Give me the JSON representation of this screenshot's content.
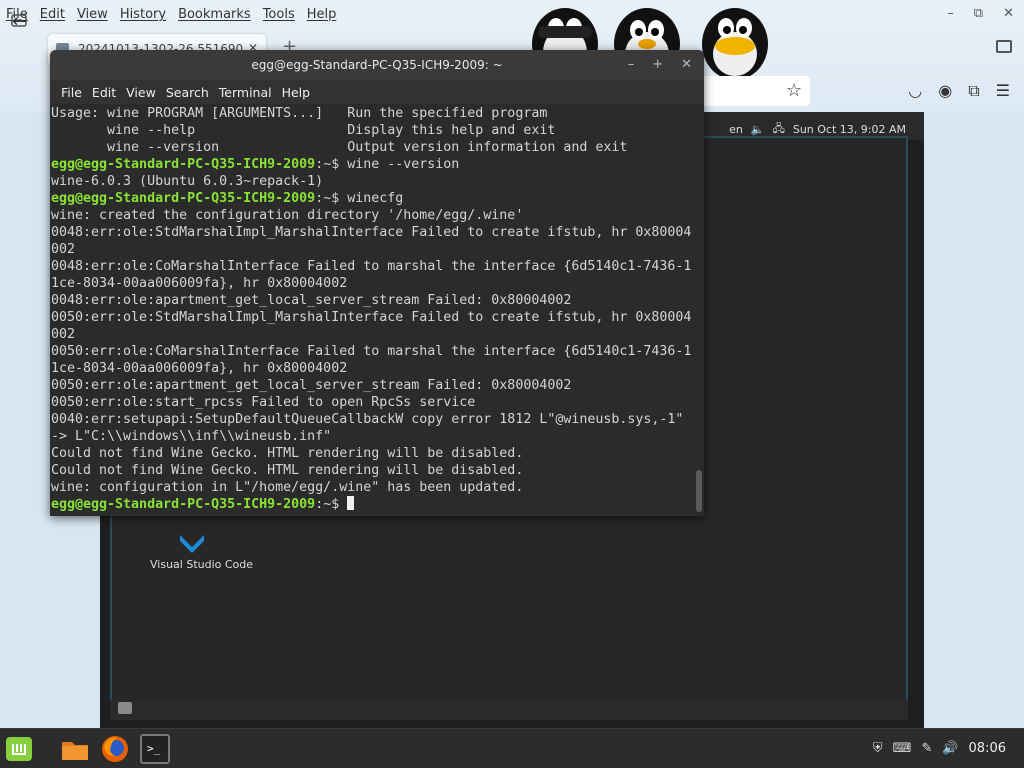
{
  "browser": {
    "menu": [
      "File",
      "Edit",
      "View",
      "History",
      "Bookmarks",
      "Tools",
      "Help"
    ],
    "tab_title": "20241013-1302-26.551690",
    "new_tab_label": "+",
    "window_controls": {
      "minimize": "–",
      "restore": "⧉",
      "close": "✕"
    }
  },
  "vm": {
    "tray_lang": "en",
    "tray_datetime": "Sun Oct 13,  9:02 AM",
    "desktop_icon_label": "Visual Studio Code"
  },
  "terminal": {
    "title": "egg@egg-Standard-PC-Q35-ICH9-2009: ~",
    "menu": [
      "File",
      "Edit",
      "View",
      "Search",
      "Terminal",
      "Help"
    ],
    "lines": [
      {
        "text": "Usage: wine PROGRAM [ARGUMENTS...]   Run the specified program"
      },
      {
        "text": "       wine --help                   Display this help and exit"
      },
      {
        "text": "       wine --version                Output version information and exit"
      },
      {
        "prompt": "egg@egg-Standard-PC-Q35-ICH9-2009",
        "path": ":~$ ",
        "cmd": "wine --version"
      },
      {
        "text": "wine-6.0.3 (Ubuntu 6.0.3~repack-1)"
      },
      {
        "prompt": "egg@egg-Standard-PC-Q35-ICH9-2009",
        "path": ":~$ ",
        "cmd": "winecfg"
      },
      {
        "text": "wine: created the configuration directory '/home/egg/.wine'"
      },
      {
        "text": "0048:err:ole:StdMarshalImpl_MarshalInterface Failed to create ifstub, hr 0x80004"
      },
      {
        "text": "002"
      },
      {
        "text": "0048:err:ole:CoMarshalInterface Failed to marshal the interface {6d5140c1-7436-1"
      },
      {
        "text": "1ce-8034-00aa006009fa}, hr 0x80004002"
      },
      {
        "text": "0048:err:ole:apartment_get_local_server_stream Failed: 0x80004002"
      },
      {
        "text": "0050:err:ole:StdMarshalImpl_MarshalInterface Failed to create ifstub, hr 0x80004"
      },
      {
        "text": "002"
      },
      {
        "text": "0050:err:ole:CoMarshalInterface Failed to marshal the interface {6d5140c1-7436-1"
      },
      {
        "text": "1ce-8034-00aa006009fa}, hr 0x80004002"
      },
      {
        "text": "0050:err:ole:apartment_get_local_server_stream Failed: 0x80004002"
      },
      {
        "text": "0050:err:ole:start_rpcss Failed to open RpcSs service"
      },
      {
        "text": "0040:err:setupapi:SetupDefaultQueueCallbackW copy error 1812 L\"@wineusb.sys,-1\""
      },
      {
        "text": "-> L\"C:\\\\windows\\\\inf\\\\wineusb.inf\""
      },
      {
        "text": "Could not find Wine Gecko. HTML rendering will be disabled."
      },
      {
        "text": "Could not find Wine Gecko. HTML rendering will be disabled."
      },
      {
        "text": "wine: configuration in L\"/home/egg/.wine\" has been updated."
      },
      {
        "prompt": "egg@egg-Standard-PC-Q35-ICH9-2009",
        "path": ":~$ ",
        "cmd": "",
        "cursor": true
      }
    ]
  },
  "taskbar": {
    "terminal_btn_text": ">_",
    "clock": "08:06"
  },
  "colors": {
    "prompt": "#8ae234",
    "terminal_bg": "#2b2b2b",
    "taskbar_bg": "#2c2c2c"
  }
}
